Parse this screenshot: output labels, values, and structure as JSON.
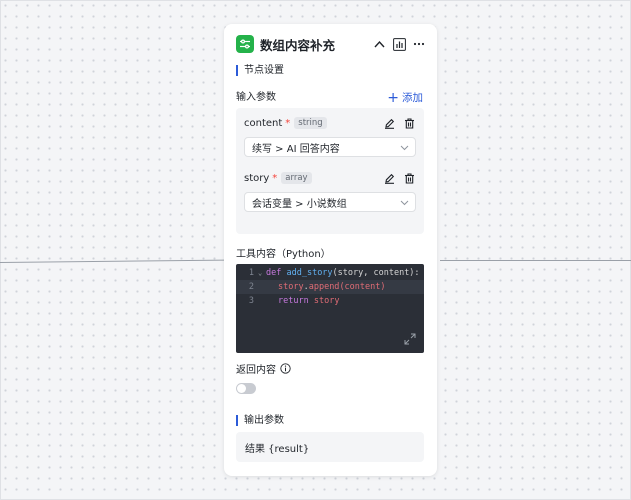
{
  "node": {
    "title": "数组内容补充",
    "icons": {
      "app": "sliders-icon",
      "collapse": "chevron-up-icon",
      "chart": "bar-chart-icon",
      "more": "more-icon"
    }
  },
  "node_settings": {
    "title": "节点设置"
  },
  "input_params": {
    "label": "输入参数",
    "add_label": "添加",
    "params": [
      {
        "name": "content",
        "required": "*",
        "type": "string",
        "value": "续写 > AI 回答内容"
      },
      {
        "name": "story",
        "required": "*",
        "type": "array",
        "value": "会话变量 > 小说数组"
      }
    ]
  },
  "tool_content": {
    "label": "工具内容（Python）",
    "lines": [
      {
        "num": "1",
        "kw": "def",
        "fn": "add_story",
        "rest": "(story, content):"
      },
      {
        "num": "2",
        "obj": "story",
        "dot": ".",
        "call": "append",
        "arg": "(content)"
      },
      {
        "num": "3",
        "kw": "return",
        "var": "story"
      }
    ]
  },
  "return_content": {
    "label": "返回内容",
    "enabled": false
  },
  "output_params": {
    "title": "输出参数",
    "value": "结果 {result}"
  },
  "colors": {
    "accent": "#2c5bd8",
    "app_icon": "#24b24a",
    "required": "#f5453c",
    "code_bg": "#2b2f37"
  }
}
